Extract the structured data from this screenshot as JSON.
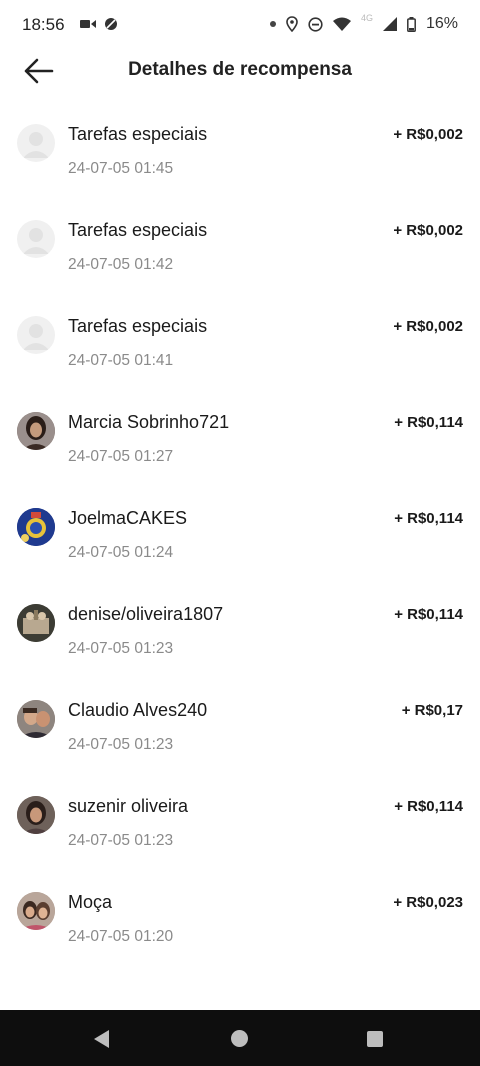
{
  "status_bar": {
    "time": "18:56",
    "battery": "16%",
    "network": "4G",
    "icons": [
      "video-icon",
      "camera-disabled-icon",
      "location-icon",
      "dnd-icon",
      "wifi-icon",
      "signal-icon",
      "battery-icon"
    ]
  },
  "header": {
    "title": "Detalhes de recompensa",
    "back_icon": "arrow-left-icon"
  },
  "rewards": [
    {
      "name": "Tarefas especiais",
      "time": "24-07-05 01:45",
      "amount": "+ R$0,002",
      "avatar": "placeholder"
    },
    {
      "name": "Tarefas especiais",
      "time": "24-07-05 01:42",
      "amount": "+ R$0,002",
      "avatar": "placeholder"
    },
    {
      "name": "Tarefas especiais",
      "time": "24-07-05 01:41",
      "amount": "+ R$0,002",
      "avatar": "placeholder"
    },
    {
      "name": "Marcia Sobrinho721",
      "time": "24-07-05 01:27",
      "amount": "+ R$0,114",
      "avatar": "photo"
    },
    {
      "name": "JoelmaCAKES",
      "time": "24-07-05 01:24",
      "amount": "+ R$0,114",
      "avatar": "photo"
    },
    {
      "name": "denise/oliveira1807",
      "time": "24-07-05 01:23",
      "amount": "+ R$0,114",
      "avatar": "photo"
    },
    {
      "name": "Claudio Alves240",
      "time": "24-07-05 01:23",
      "amount": "+ R$0,17",
      "avatar": "photo"
    },
    {
      "name": "suzenir oliveira",
      "time": "24-07-05 01:23",
      "amount": "+ R$0,114",
      "avatar": "photo"
    },
    {
      "name": "Moça",
      "time": "24-07-05 01:20",
      "amount": "+ R$0,023",
      "avatar": "photo"
    }
  ],
  "nav_bar": {
    "icons": [
      "nav-back-icon",
      "nav-home-icon",
      "nav-recents-icon"
    ]
  }
}
